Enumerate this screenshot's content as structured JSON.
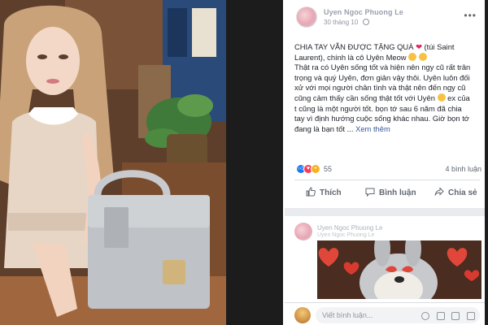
{
  "post": {
    "author": "Uyen Ngoc Phuong Le",
    "date": "30 tháng 10",
    "body_lines": [
      "CHIA TAY VẪN ĐƯỢC TẶNG QUÀ",
      "Laurent), chính là cô Uyên Meow",
      "Thật ra có Uyên sống tốt và hiện nên ngy cũ rất trân",
      "trọng và quý Uyên, đơn giản vậy thôi. Uyên luôn đối",
      "xử với mọi người chân tình và thật nên đến ngy cũ",
      "cũng cảm thấy cần sống thật tốt với Uyên",
      "t cũng là một người tốt. bọn tớ sau 6 năm đã chia",
      "tay vì định hướng cuộc sống khác nhau. Giờ bọn tớ",
      "đang là bạn tốt ..."
    ],
    "line1_suffix": "(túi Saint",
    "line6_suffix": "ex của",
    "see_more": "Xem thêm",
    "reaction_count": "55",
    "comments_count": "4 bình luận",
    "actions": {
      "like": "Thích",
      "comment": "Bình luận",
      "share": "Chia sẻ"
    }
  },
  "shared": {
    "author": "Uyen Ngoc Phuong Le",
    "sub": "Uyen Ngoc Phuong Le"
  },
  "comment_box": {
    "placeholder": "Viết bình luận..."
  },
  "icons": {
    "like": "thumbs-up-icon",
    "comment": "comment-bubble-icon",
    "share": "share-arrow-icon",
    "globe": "globe-icon",
    "more": "more-dots-icon"
  },
  "colors": {
    "link": "#385898",
    "text": "#1d2129",
    "muted": "#606770",
    "like_blue": "#1877f2",
    "love_red": "#f33e58",
    "wow_yellow": "#f7b125"
  }
}
